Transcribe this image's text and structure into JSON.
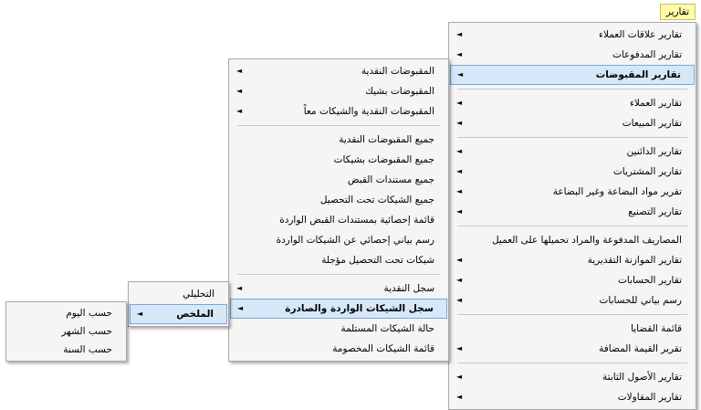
{
  "top_menu": {
    "label": "تقارير"
  },
  "main_menu": {
    "g1": [
      "تقارير علاقات العملاء",
      "تقارير المدفوعات",
      "تقارير المقبوضات"
    ],
    "g2": [
      "تقارير العملاء",
      "تقارير المبيعات"
    ],
    "g3": [
      "تقارير الدائنين",
      "تقارير المشتريات",
      "تقرير مواد البضاعة وغير البضاعة",
      "تقارير التصنيع"
    ],
    "g4": [
      "المصاريف المدفوعة والمراد تحميلها على العميل",
      "تقارير الموازنة التقديرية",
      "تقارير الحسابات",
      "رسم بياني للحسابات"
    ],
    "g5": [
      "قائمة القضايا",
      "تقرير القيمة المضافة"
    ],
    "g6": [
      "تقارير الأصول الثابتة",
      "تقارير المقاولات"
    ]
  },
  "receipts_menu": {
    "g1": [
      "المقبوضات النقدية",
      "المقبوضات بشيك",
      "المقبوضات النقدية والشيكات معاً"
    ],
    "g2": [
      "جميع المقبوضات النقدية",
      "جميع المقبوضات بشيكات",
      "جميع مستندات القبض",
      "جميع الشيكات تحت التحصيل",
      "قائمة إحصائية بمستندات القبض الواردة",
      "رسم بياني إحصائي عن الشيكات الواردة",
      "شيكات تحت التحصيل مؤجلة"
    ],
    "g3": [
      "سجل النقدية",
      "سجل الشيكات الواردة والصادرة",
      "حالة الشيكات المستلمة",
      "قائمة الشيكات المخصومة"
    ]
  },
  "checks_register_menu": {
    "items": [
      "التحليلي",
      "الملخص"
    ]
  },
  "summary_menu": {
    "items": [
      "حسب اليوم",
      "حسب الشهر",
      "حسب السنة"
    ]
  },
  "icons": {
    "submenu_arrow": "◄"
  }
}
